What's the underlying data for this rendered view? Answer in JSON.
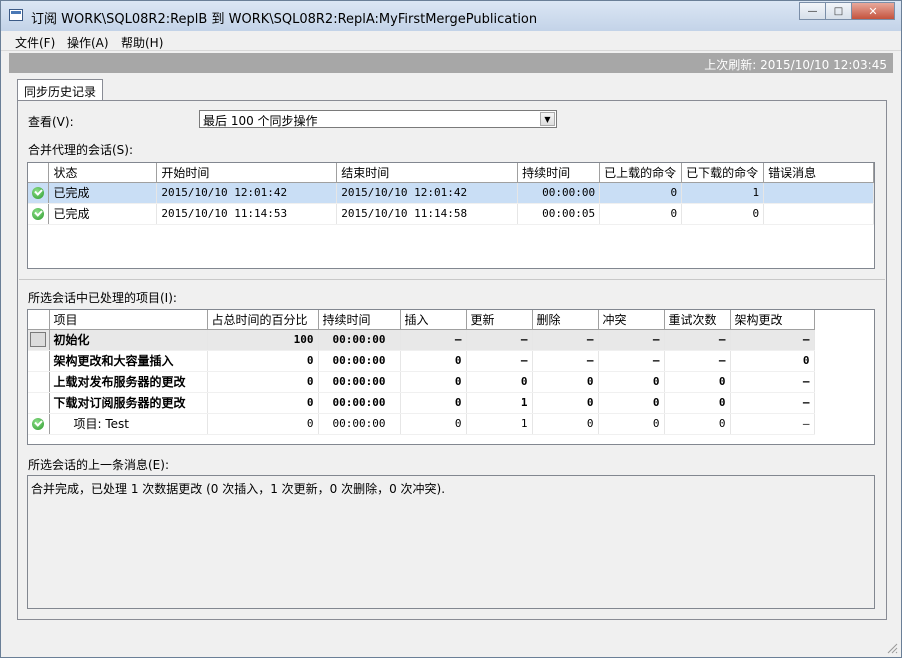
{
  "window": {
    "title": "订阅 WORK\\SQL08R2:ReplB 到 WORK\\SQL08R2:ReplA:MyFirstMergePublication",
    "icon": "app-window-icon",
    "minimize": "—",
    "maximize": "□",
    "close": "✕"
  },
  "menu": [
    "文件(F)",
    "操作(A)",
    "帮助(H)"
  ],
  "refresh": "上次刷新: 2015/10/10 12:03:45",
  "tab": "同步历史记录",
  "view": {
    "label": "查看(V):",
    "value": "最后 100 个同步操作"
  },
  "sessions": {
    "label": "合并代理的会话(S):",
    "columns": [
      "状态",
      "开始时间",
      "结束时间",
      "持续时间",
      "已上载的命令",
      "已下载的命令",
      "错误消息"
    ],
    "rows": [
      {
        "status": "已完成",
        "start": "2015/10/10 12:01:42",
        "end": "2015/10/10 12:01:42",
        "duration": "00:00:00",
        "uploaded": "0",
        "downloaded": "1",
        "error": ""
      },
      {
        "status": "已完成",
        "start": "2015/10/10 11:14:53",
        "end": "2015/10/10 11:14:58",
        "duration": "00:00:05",
        "uploaded": "0",
        "downloaded": "0",
        "error": ""
      }
    ]
  },
  "items": {
    "label": "所选会话中已处理的项目(I):",
    "columns": [
      "项目",
      "占总时间的百分比",
      "持续时间",
      "插入",
      "更新",
      "删除",
      "冲突",
      "重试次数",
      "架构更改"
    ],
    "rows": [
      {
        "name": "初始化",
        "pct": "100",
        "duration": "00:00:00",
        "insert": "–",
        "update": "–",
        "delete": "–",
        "conflict": "–",
        "retry": "–",
        "schema": "–"
      },
      {
        "name": "架构更改和大容量插入",
        "pct": "0",
        "duration": "00:00:00",
        "insert": "0",
        "update": "–",
        "delete": "–",
        "conflict": "–",
        "retry": "–",
        "schema": "0"
      },
      {
        "name": "上载对发布服务器的更改",
        "pct": "0",
        "duration": "00:00:00",
        "insert": "0",
        "update": "0",
        "delete": "0",
        "conflict": "0",
        "retry": "0",
        "schema": "–"
      },
      {
        "name": "下载对订阅服务器的更改",
        "pct": "0",
        "duration": "00:00:00",
        "insert": "0",
        "update": "1",
        "delete": "0",
        "conflict": "0",
        "retry": "0",
        "schema": "–"
      },
      {
        "name": "项目: Test",
        "pct": "0",
        "duration": "00:00:00",
        "insert": "0",
        "update": "1",
        "delete": "0",
        "conflict": "0",
        "retry": "0",
        "schema": "–"
      }
    ]
  },
  "last_message": {
    "label": "所选会话的上一条消息(E):",
    "text": "合并完成，已处理 1 次数据更改 (0 次插入，1 次更新，0 次删除，0 次冲突)."
  },
  "colors": {
    "selected_row": "#c9def5",
    "refresh_bar": "#a7a7a7",
    "success": "#2c9a2c"
  }
}
